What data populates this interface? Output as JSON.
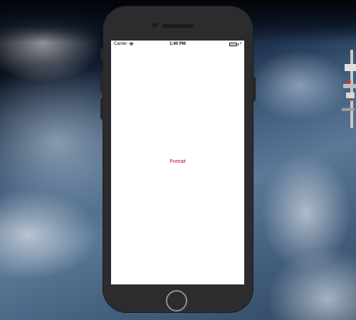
{
  "status_bar": {
    "carrier": "Carrier",
    "time": "1:40 PM",
    "wifi_icon": "wifi-icon",
    "battery_icon": "battery-icon",
    "battery_level": 1.0,
    "battery_color": "#4cd964"
  },
  "screen": {
    "label": "Portrait",
    "label_color": "#d0021b",
    "background": "#ffffff"
  },
  "device": {
    "home_button_icon": "home-button"
  }
}
